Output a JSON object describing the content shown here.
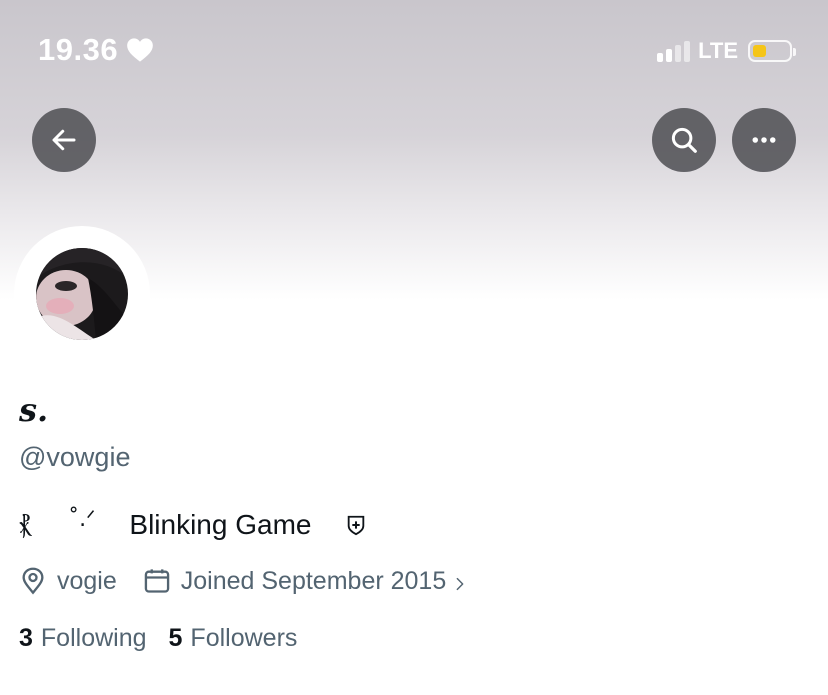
{
  "colors": {
    "accent_battery": "#f5c518",
    "muted_text": "#536471",
    "primary_text": "#0f1419"
  },
  "status_bar": {
    "time": "19.36",
    "heart_icon": "heart-icon",
    "network": "LTE",
    "battery_level": 0.35
  },
  "nav": {
    "back_icon": "arrow-left-icon",
    "search_icon": "search-icon",
    "more_icon": "more-horizontal-icon"
  },
  "profile": {
    "display_name": "s.",
    "handle": "@vowgie",
    "bio": {
      "deco_left": "⳩",
      "deco_mid": "˚.ᐟ",
      "text": "Blinking Game",
      "shield_icon": "shield-plus-icon"
    },
    "location": "vogie",
    "joined": "Joined September 2015",
    "following_count": "3",
    "following_label": "Following",
    "followers_count": "5",
    "followers_label": "Followers"
  }
}
